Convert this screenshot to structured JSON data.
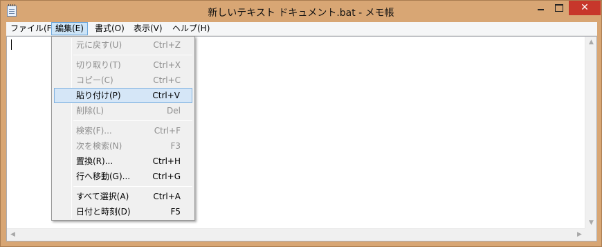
{
  "window": {
    "title": "新しいテキスト ドキュメント.bat - メモ帳",
    "close_glyph": "✕"
  },
  "menubar": [
    {
      "label": "ファイル(F)"
    },
    {
      "label": "編集(E)"
    },
    {
      "label": "書式(O)"
    },
    {
      "label": "表示(V)"
    },
    {
      "label": "ヘルプ(H)"
    }
  ],
  "edit_menu": {
    "items": [
      {
        "label": "元に戻す(U)",
        "shortcut": "Ctrl+Z"
      },
      {
        "label": "切り取り(T)",
        "shortcut": "Ctrl+X"
      },
      {
        "label": "コピー(C)",
        "shortcut": "Ctrl+C"
      },
      {
        "label": "貼り付け(P)",
        "shortcut": "Ctrl+V"
      },
      {
        "label": "削除(L)",
        "shortcut": "Del"
      },
      {
        "label": "検索(F)...",
        "shortcut": "Ctrl+F"
      },
      {
        "label": "次を検索(N)",
        "shortcut": "F3"
      },
      {
        "label": "置換(R)...",
        "shortcut": "Ctrl+H"
      },
      {
        "label": "行へ移動(G)...",
        "shortcut": "Ctrl+G"
      },
      {
        "label": "すべて選択(A)",
        "shortcut": "Ctrl+A"
      },
      {
        "label": "日付と時刻(D)",
        "shortcut": "F5"
      }
    ]
  },
  "scrollbar": {
    "up": "▲",
    "down": "▼",
    "left": "◀",
    "right": "▶"
  },
  "colors": {
    "frame": "#d8a674",
    "close": "#c7372b",
    "menu_highlight": "#cce4f7"
  }
}
